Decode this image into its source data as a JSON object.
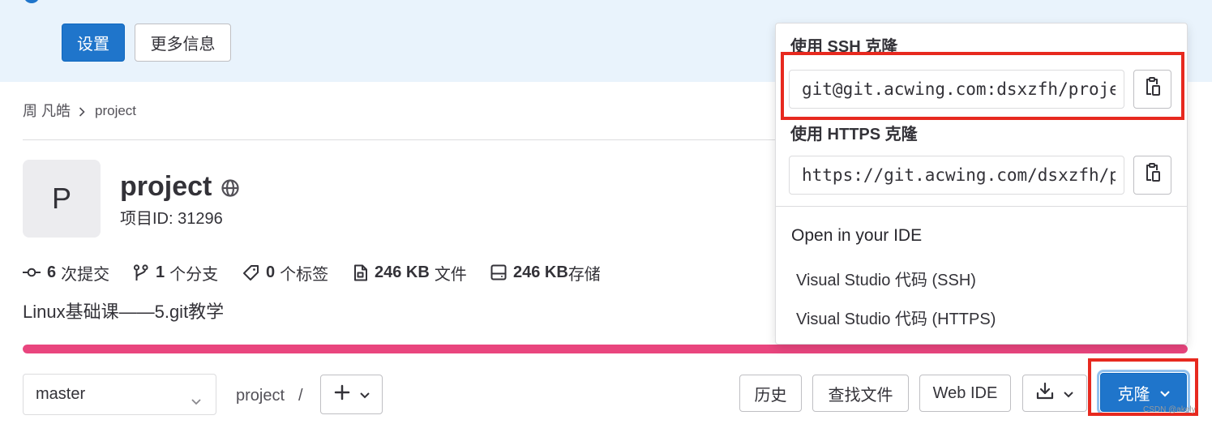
{
  "colors": {
    "accent": "#1f75cb",
    "banner": "#e9f3fc",
    "language_bar": "#e9457e",
    "annotation": "#e7291f"
  },
  "banner": {
    "icon": "info-circle-icon",
    "settings_button": "设置",
    "more_info_button": "更多信息"
  },
  "breadcrumb": {
    "items": [
      "周 凡皓",
      "project"
    ],
    "separator_icon": "chevron-right-icon"
  },
  "project": {
    "avatar_letter": "P",
    "name": "project",
    "visibility_icon": "globe-icon",
    "id_text": "项目ID: 31296",
    "stats": [
      {
        "icon": "commit-icon",
        "value": "6",
        "label": "次提交"
      },
      {
        "icon": "branch-icon",
        "value": "1",
        "label": "个分支"
      },
      {
        "icon": "tag-icon",
        "value": "0",
        "label": "个标签"
      },
      {
        "icon": "file-icon",
        "value": "246 KB",
        "label": "文件"
      },
      {
        "icon": "storage-icon",
        "value": "246 KB",
        "label": "存储"
      }
    ],
    "description": "Linux基础课——5.git教学",
    "language_bar": {
      "fill": 1.0
    }
  },
  "toolbar": {
    "branch_select": "master",
    "path": "project",
    "path_separator": "/",
    "add_icon": "plus-icon",
    "history_button": "历史",
    "find_file_button": "查找文件",
    "web_ide_button": "Web IDE",
    "download_icon": "download-icon",
    "clone_button": "克隆"
  },
  "clone_dropdown": {
    "ssh_label": "使用 SSH 克隆",
    "ssh_url": "git@git.acwing.com:dsxzfh/proje",
    "https_label": "使用 HTTPS 克隆",
    "https_url": "https://git.acwing.com/dsxzfh/p",
    "copy_icon": "clipboard-icon",
    "ide_heading": "Open in your IDE",
    "ide_options": [
      "Visual Studio 代码 (SSH)",
      "Visual Studio 代码 (HTTPS)"
    ]
  },
  "watermark": "CSDN @akely"
}
